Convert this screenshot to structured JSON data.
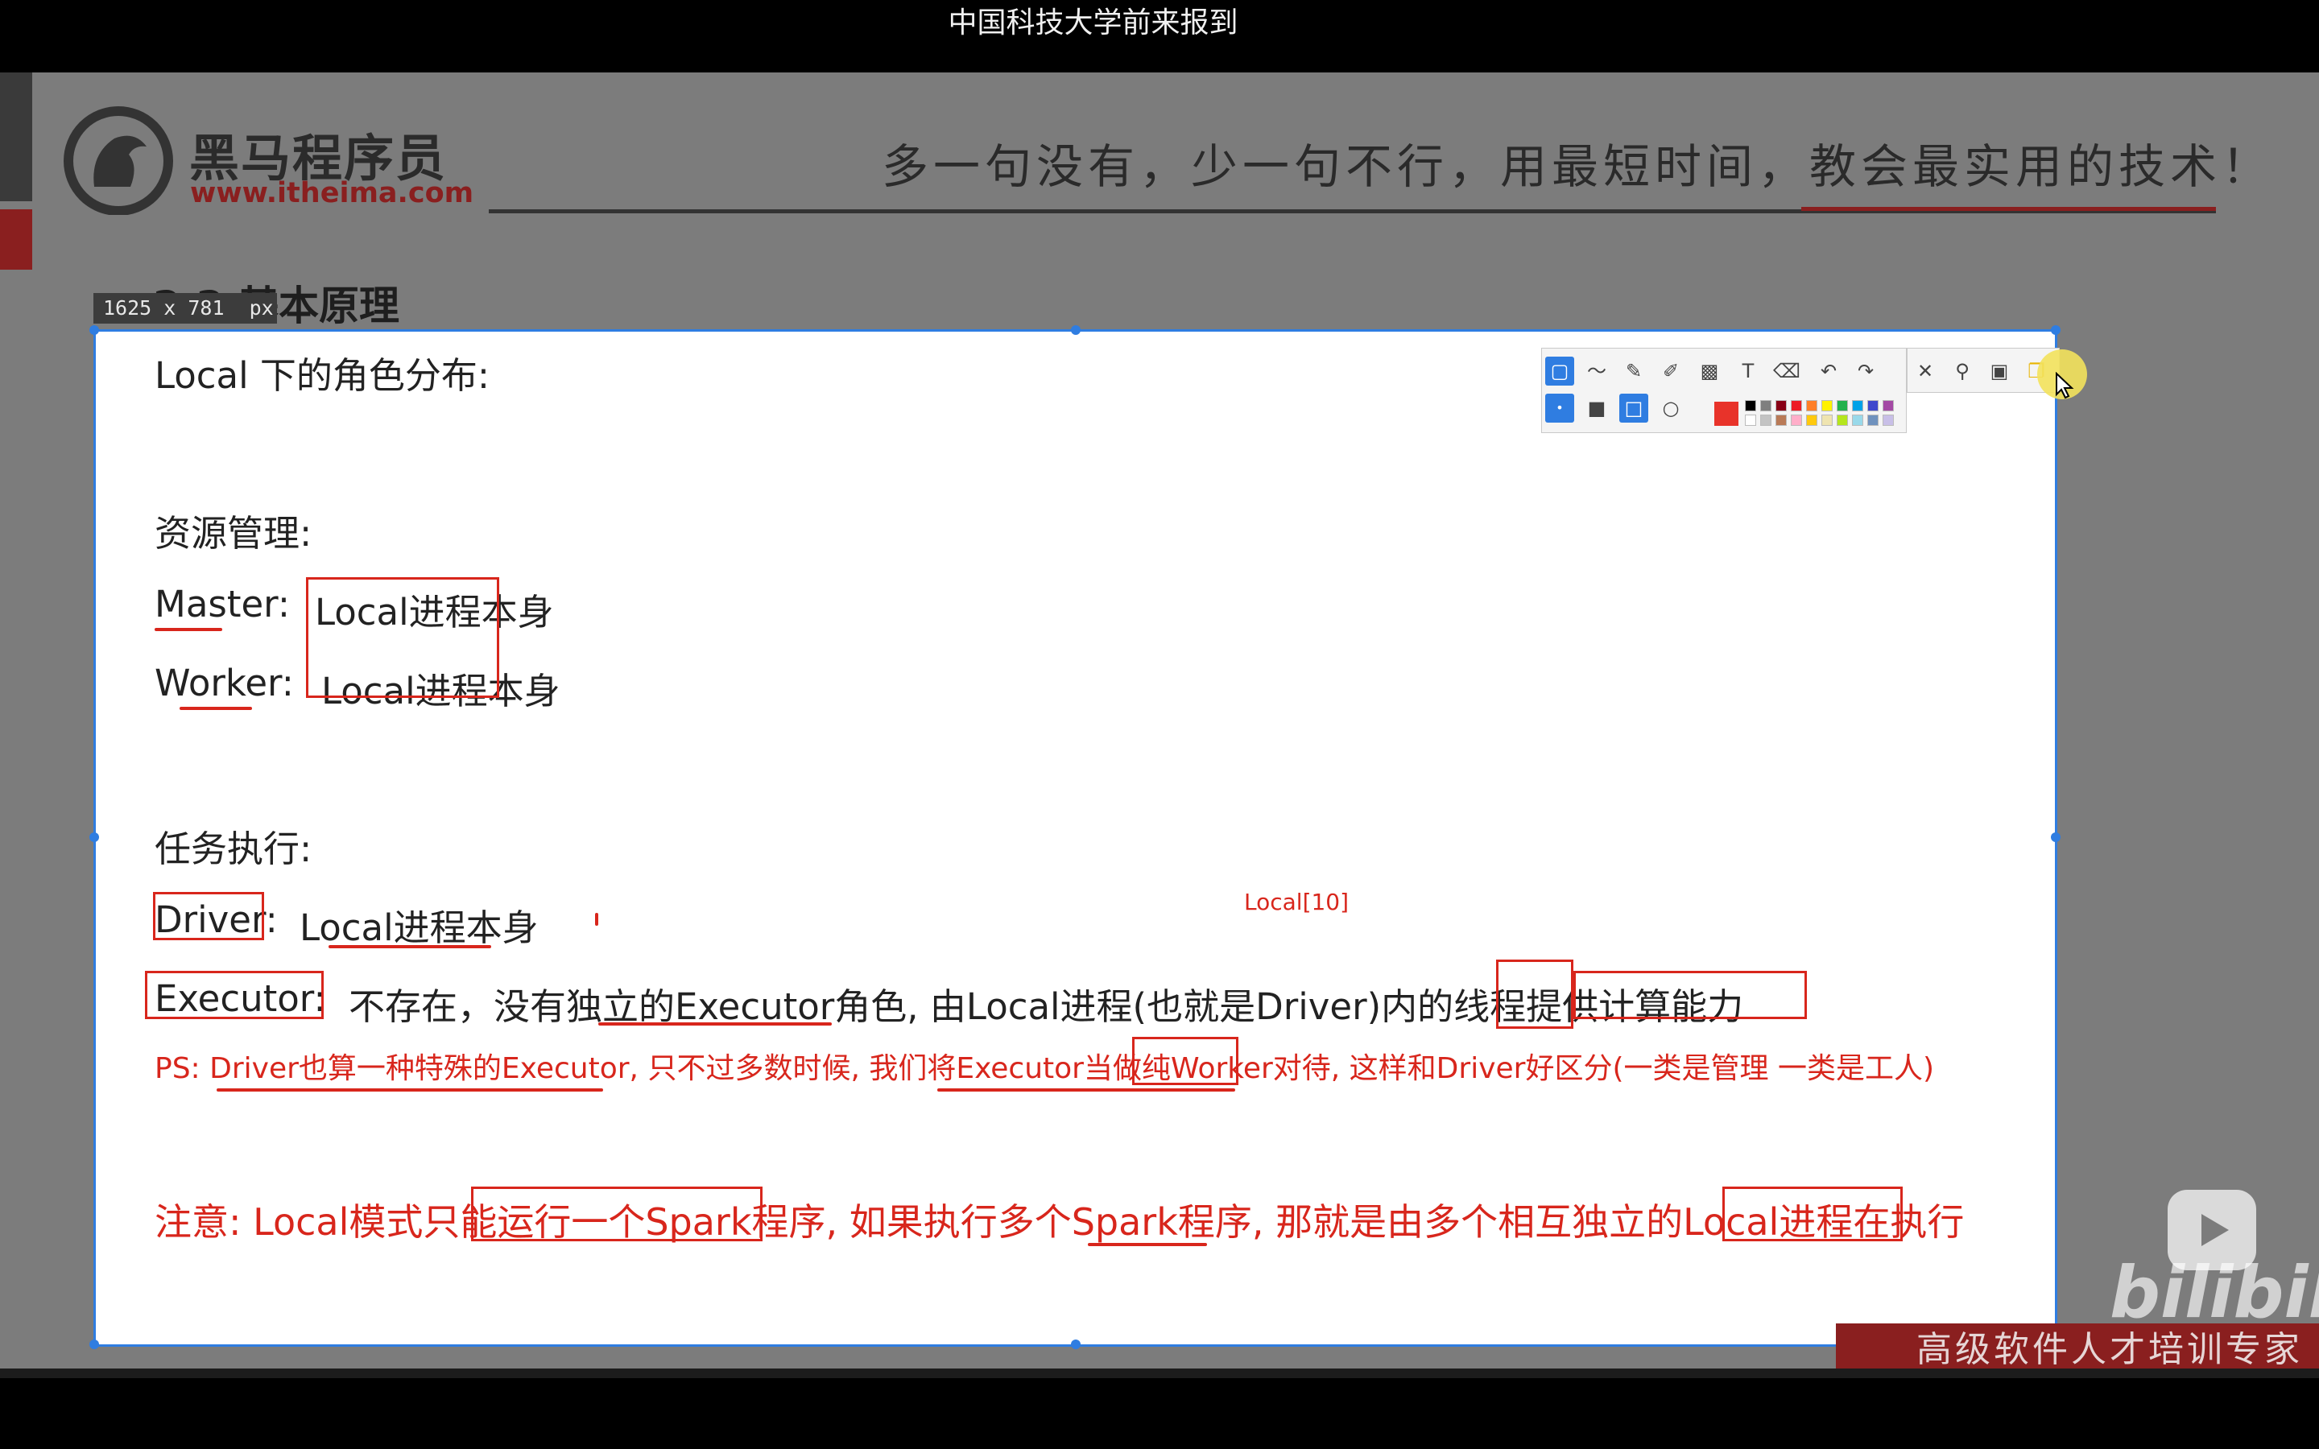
{
  "danmaku": "中国科技大学前来报到",
  "logo": {
    "name_cn": "黑马程序员",
    "url": "www.itheima.com"
  },
  "slogan": "多一句没有，少一句不行，用最短时间，教会最实用的技术！",
  "section_title": "2.2 基本原理",
  "capture_size": {
    "label": "1625 x 781",
    "unit": "px"
  },
  "content": {
    "heading": "Local 下的角色分布:",
    "resource_title": "资源管理:",
    "master_key": "Master:",
    "master_value": "Local进程本身",
    "worker_key": "Worker:",
    "worker_value": "Local进程本身",
    "task_title": "任务执行:",
    "driver_key": "Driver:",
    "driver_value": "Local进程本身",
    "executor_key": "Executor:",
    "executor_value": "不存在，没有独立的Executor角色, 由Local进程(也就是Driver)内的线程提供计算能力",
    "ps_note": "PS: Driver也算一种特殊的Executor, 只不过多数时候, 我们将Executor当做纯Worker对待, 这样和Driver好区分(一类是管理 一类是工人)",
    "warning": "注意: Local模式只能运行一个Spark程序, 如果执行多个Spark程序, 那就是由多个相互独立的Local进程在执行"
  },
  "annotation_label": "Local[10]",
  "toolbar": {
    "tools": [
      "select-tool",
      "polyline-tool",
      "pen-tool",
      "marker-tool",
      "mosaic-tool",
      "text-tool",
      "eraser-tool",
      "undo",
      "redo",
      "close",
      "pin",
      "save",
      "copy"
    ],
    "selected_color": "#e8332a",
    "palette": [
      "#000000",
      "#7f7f7f",
      "#880015",
      "#ed1c24",
      "#ff7f27",
      "#fff200",
      "#22b14c",
      "#00a2e8",
      "#3f48cc",
      "#a349a4",
      "#ffffff",
      "#c3c3c3",
      "#b97a57",
      "#ffaec9",
      "#ffc90e",
      "#efe4b0",
      "#b5e61d",
      "#99d9ea",
      "#7092be",
      "#c8bfe7"
    ]
  },
  "branding": {
    "tagline": "高级软件人才培训专家",
    "bilibili": "bilibili"
  },
  "colors": {
    "accent_red": "#d8261c",
    "selection_blue": "#2f7de1"
  }
}
